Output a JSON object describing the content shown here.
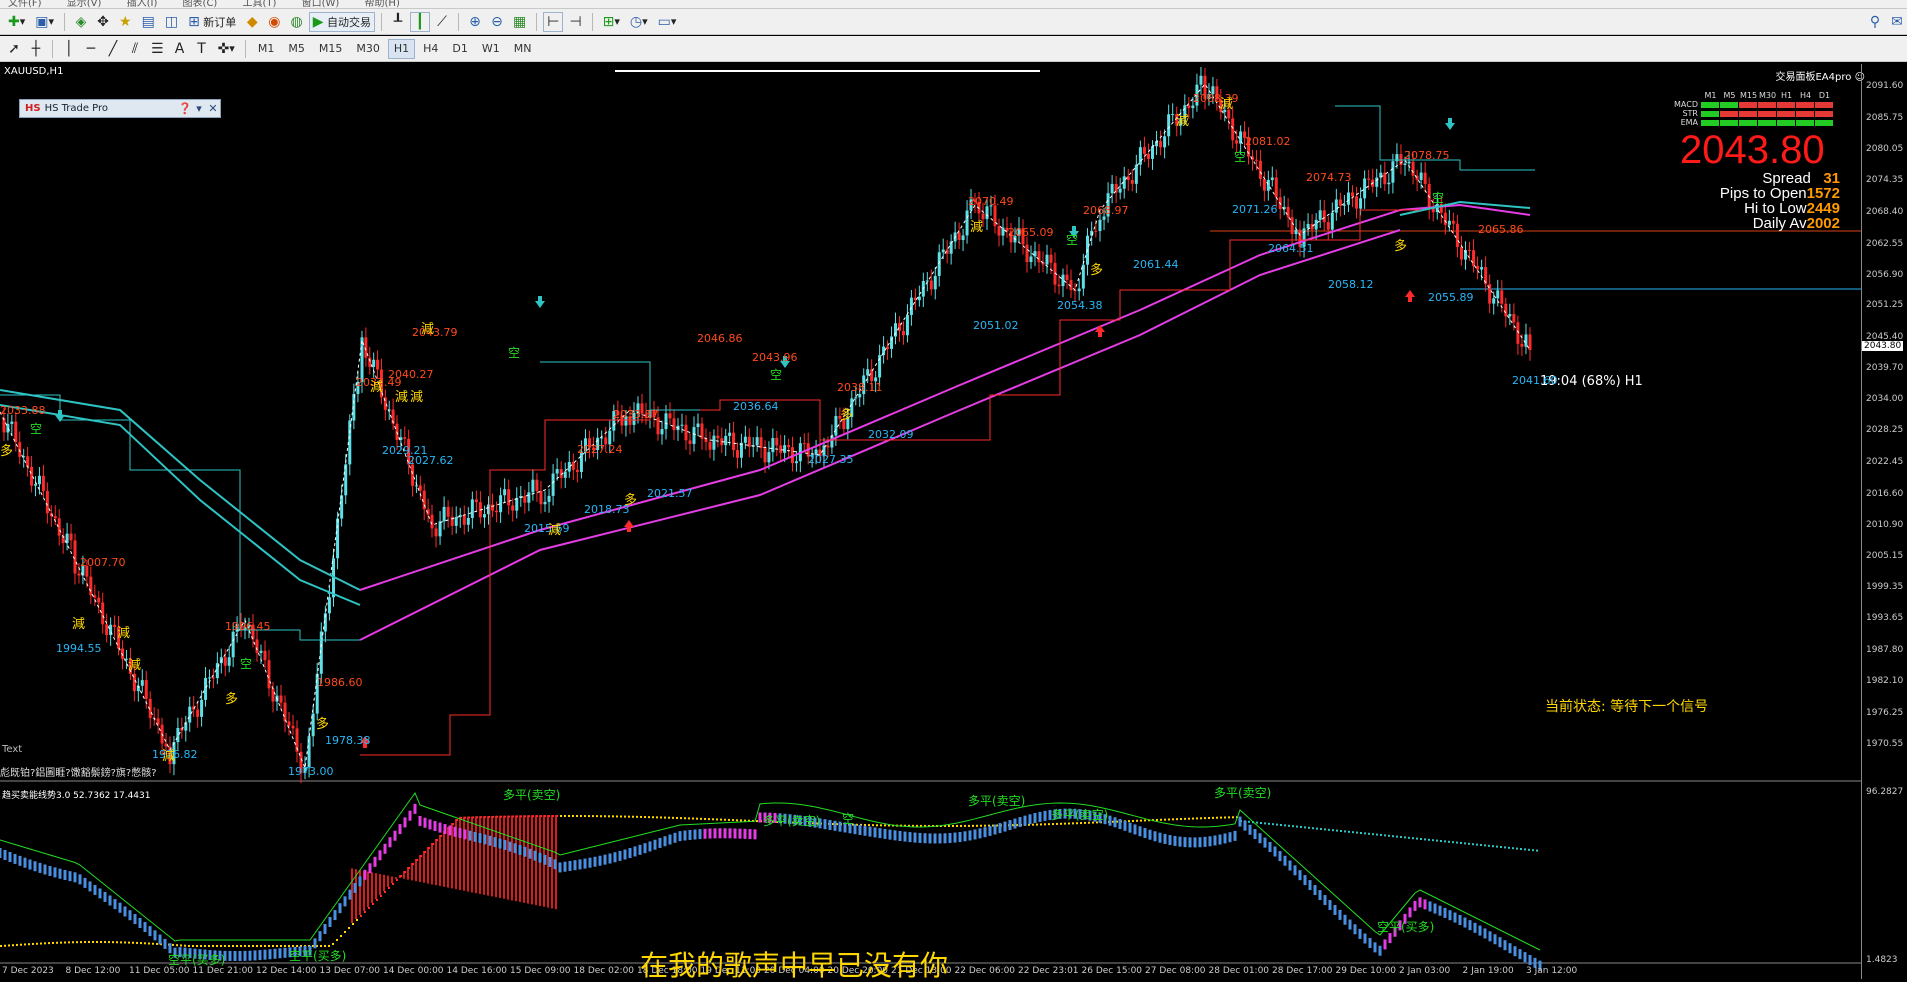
{
  "menubar": {
    "items": [
      "文件(F)",
      "显示(V)",
      "插入(I)",
      "图表(C)",
      "工具(T)",
      "窗口(W)",
      "帮助(H)"
    ]
  },
  "toolbar": {
    "new_order_label": "新订单",
    "autotrade_label": "自动交易",
    "timeframes": [
      "M1",
      "M5",
      "M15",
      "M30",
      "H1",
      "H4",
      "D1",
      "W1",
      "MN"
    ],
    "active_timeframe": "H1"
  },
  "chart": {
    "symbol": "XAUUSD,H1",
    "panel_title": "HS Trade Pro",
    "panel_logo": "HS",
    "topright_label": "交易面板EA4pro",
    "big_price": "2043.80",
    "stats": {
      "spread_label": "Spread",
      "spread_value": "31",
      "pips_label": "Pips to Open",
      "pips_value": "1572",
      "hilo_label": "Hi to Low",
      "hilo_value": "2449",
      "daily_label": "Daily Av",
      "daily_value": "2002"
    },
    "signal_table": {
      "header": [
        "M1",
        "M5",
        "M15",
        "M30",
        "H1",
        "H4",
        "D1"
      ],
      "rows": [
        {
          "label": "MACD",
          "colors": [
            "#22cc22",
            "#22cc22",
            "#e53935",
            "#e53935",
            "#e53935",
            "#e53935",
            "#e53935"
          ]
        },
        {
          "label": "STR",
          "colors": [
            "#22cc22",
            "#e53935",
            "#e53935",
            "#e53935",
            "#e53935",
            "#e53935",
            "#e53935"
          ]
        },
        {
          "label": "EMA",
          "colors": [
            "#22cc22",
            "#22cc22",
            "#22cc22",
            "#22cc22",
            "#22cc22",
            "#22cc22",
            "#22cc22"
          ]
        }
      ]
    },
    "status_text": "当前状态: 等待下一个信号",
    "timer_text": "19:04 (68%) H1",
    "current_price": "2043.80",
    "left_text": "Text",
    "left_garbled": "彪既铂?鋁圖睚?馓豁鬃鎊?旗?憋骸?",
    "indicator_label": "趋买卖能线势3.0 52.7362 17.4431",
    "subtitle": "在我的歌声中早已没有你",
    "price_axis": [
      "2091.60",
      "2085.75",
      "2080.05",
      "2074.35",
      "2068.40",
      "2062.55",
      "2056.90",
      "2051.25",
      "2045.40",
      "2043.80",
      "2039.70",
      "2034.00",
      "2028.25",
      "2022.45",
      "2016.60",
      "2010.90",
      "2005.15",
      "1999.35",
      "1993.65",
      "1987.80",
      "1982.10",
      "1976.25",
      "1970.55",
      "96.2827",
      "1.4823"
    ],
    "time_axis": [
      "7 Dec 2023",
      "8 Dec 12:00",
      "11 Dec 05:00",
      "11 Dec 21:00",
      "12 Dec 14:00",
      "13 Dec 07:00",
      "14 Dec 00:00",
      "14 Dec 16:00",
      "15 Dec 09:00",
      "18 Dec 02:00",
      "18 Dec 18:00",
      "19 Dec 11:00",
      "20 Dec 04:00",
      "20 Dec 20:00",
      "21 Dec 13:00",
      "22 Dec 06:00",
      "22 Dec 23:01",
      "26 Dec 15:00",
      "27 Dec 08:00",
      "28 Dec 01:00",
      "28 Dec 17:00",
      "29 Dec 10:00",
      "2 Jan 03:00",
      "2 Jan 19:00",
      "3 Jan 12:00"
    ],
    "swing_labels_orange": [
      "2033.88",
      "2007.70",
      "1996.45",
      "1986.60",
      "2043.79",
      "2037.49",
      "2040.27",
      "2027.24",
      "2033.57",
      "2046.86",
      "2043.96",
      "2038.11",
      "2070.49",
      "2065.09",
      "2068.97",
      "2088.39",
      "2081.02",
      "2074.73",
      "2078.75",
      "2065.86"
    ],
    "swing_labels_cyan": [
      "1994.55",
      "1976.82",
      "1973.00",
      "1978.38",
      "2029.21",
      "2027.62",
      "2015.69",
      "2018.73",
      "2021.57",
      "2036.64",
      "2027.35",
      "2032.09",
      "2051.02",
      "2054.38",
      "2061.44",
      "2071.26",
      "2064.51",
      "2058.12",
      "2055.89",
      "2041.60"
    ],
    "signal_words": {
      "sell": "減",
      "buy": "多",
      "short": "空"
    },
    "indicator_annotations": [
      "多平(卖空)",
      "多平(卖空)",
      "空",
      "多平(卖空)",
      "多平(卖空)",
      "多平(卖空)",
      "空平(买多)",
      "空平(买多)",
      "空平(买多)"
    ],
    "chart_data": {
      "type": "line",
      "x": [
        "7 Dec",
        "8 Dec",
        "11 Dec",
        "12 Dec",
        "13 Dec",
        "14 Dec",
        "15 Dec",
        "18 Dec",
        "19 Dec",
        "20 Dec",
        "21 Dec",
        "22 Dec",
        "26 Dec",
        "27 Dec",
        "28 Dec",
        "29 Dec",
        "2 Jan",
        "3 Jan"
      ],
      "series": [
        {
          "values": [
            2033.88,
            2007.7,
            1976.82,
            1996.45,
            1973.0,
            2043.79,
            2015.69,
            2033.57,
            2046.86,
            2027.35,
            2070.49,
            2054.38,
            2068.97,
            2088.39,
            2064.51,
            2078.75,
            2055.89,
            2043.8
          ]
        }
      ],
      "ylim": [
        1970.55,
        2091.6
      ],
      "grid": false
    }
  }
}
